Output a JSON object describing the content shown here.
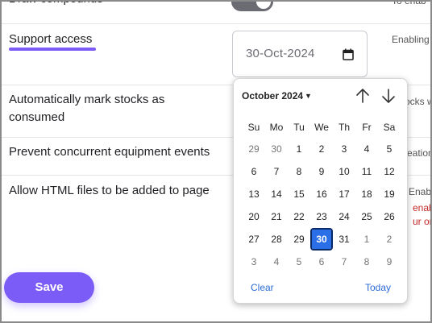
{
  "rows": [
    {
      "label": "Draw compounds",
      "desc": "To enab"
    },
    {
      "label": "Support access",
      "desc": "Enabling"
    },
    {
      "label_line1": "Automatically mark stocks as",
      "label_line2": "consumed",
      "desc": "ocks w"
    },
    {
      "label": "Prevent concurrent equipment events",
      "desc": "eation"
    },
    {
      "label": "Allow HTML files to be added to page",
      "desc_line1": "Enabling",
      "desc_line2": "enab",
      "desc_line3": "ur org"
    }
  ],
  "date_input": {
    "value": "30-Oct-2024"
  },
  "save_button": {
    "label": "Save"
  },
  "datepicker": {
    "month_label": "October 2024",
    "weekdays": [
      "Su",
      "Mo",
      "Tu",
      "We",
      "Th",
      "Fr",
      "Sa"
    ],
    "weeks": [
      [
        "29",
        "30",
        "1",
        "2",
        "3",
        "4",
        "5"
      ],
      [
        "6",
        "7",
        "8",
        "9",
        "10",
        "11",
        "12"
      ],
      [
        "13",
        "14",
        "15",
        "16",
        "17",
        "18",
        "19"
      ],
      [
        "20",
        "21",
        "22",
        "23",
        "24",
        "25",
        "26"
      ],
      [
        "27",
        "28",
        "29",
        "30",
        "31",
        "1",
        "2"
      ],
      [
        "3",
        "4",
        "5",
        "6",
        "7",
        "8",
        "9"
      ]
    ],
    "selected": "30",
    "clear_label": "Clear",
    "today_label": "Today"
  },
  "colors": {
    "accent": "#7b5cf6",
    "selected_day": "#2b6fe8",
    "link": "#2a6ad6"
  }
}
